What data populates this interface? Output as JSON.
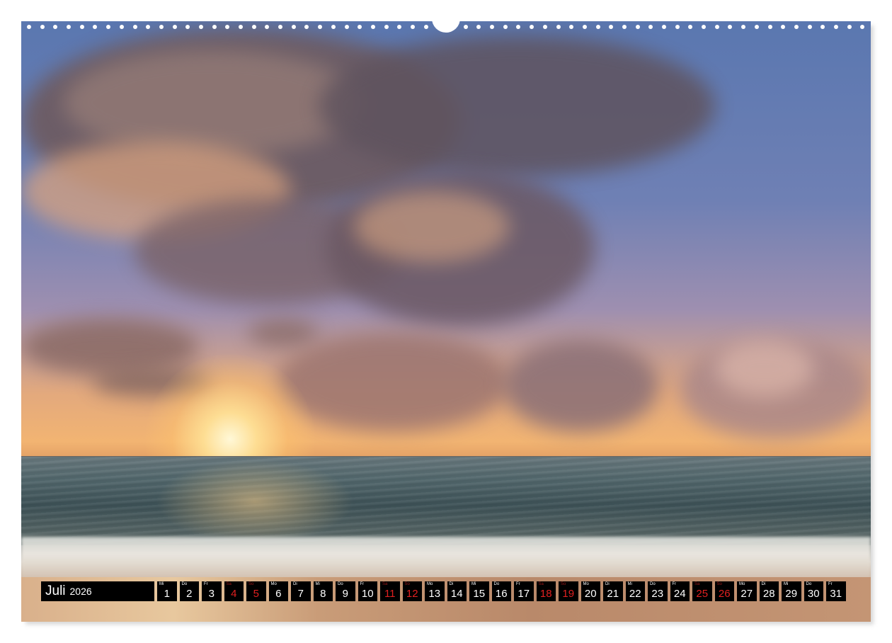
{
  "calendar": {
    "month": "Juli",
    "year": "2026",
    "days": [
      {
        "wd": "Mi",
        "num": "1",
        "weekend": false
      },
      {
        "wd": "Do",
        "num": "2",
        "weekend": false
      },
      {
        "wd": "Fr",
        "num": "3",
        "weekend": false
      },
      {
        "wd": "Sa",
        "num": "4",
        "weekend": true
      },
      {
        "wd": "So",
        "num": "5",
        "weekend": true
      },
      {
        "wd": "Mo",
        "num": "6",
        "weekend": false
      },
      {
        "wd": "Di",
        "num": "7",
        "weekend": false
      },
      {
        "wd": "Mi",
        "num": "8",
        "weekend": false
      },
      {
        "wd": "Do",
        "num": "9",
        "weekend": false
      },
      {
        "wd": "Fr",
        "num": "10",
        "weekend": false
      },
      {
        "wd": "Sa",
        "num": "11",
        "weekend": true
      },
      {
        "wd": "So",
        "num": "12",
        "weekend": true
      },
      {
        "wd": "Mo",
        "num": "13",
        "weekend": false
      },
      {
        "wd": "Di",
        "num": "14",
        "weekend": false
      },
      {
        "wd": "Mi",
        "num": "15",
        "weekend": false
      },
      {
        "wd": "Do",
        "num": "16",
        "weekend": false
      },
      {
        "wd": "Fr",
        "num": "17",
        "weekend": false
      },
      {
        "wd": "Sa",
        "num": "18",
        "weekend": true
      },
      {
        "wd": "So",
        "num": "19",
        "weekend": true
      },
      {
        "wd": "Mo",
        "num": "20",
        "weekend": false
      },
      {
        "wd": "Di",
        "num": "21",
        "weekend": false
      },
      {
        "wd": "Mi",
        "num": "22",
        "weekend": false
      },
      {
        "wd": "Do",
        "num": "23",
        "weekend": false
      },
      {
        "wd": "Fr",
        "num": "24",
        "weekend": false
      },
      {
        "wd": "Sa",
        "num": "25",
        "weekend": true
      },
      {
        "wd": "So",
        "num": "26",
        "weekend": true
      },
      {
        "wd": "Mo",
        "num": "27",
        "weekend": false
      },
      {
        "wd": "Di",
        "num": "28",
        "weekend": false
      },
      {
        "wd": "Mi",
        "num": "29",
        "weekend": false
      },
      {
        "wd": "Do",
        "num": "30",
        "weekend": false
      },
      {
        "wd": "Fr",
        "num": "31",
        "weekend": false
      }
    ]
  },
  "colors": {
    "bar_background": "#000000",
    "weekday_text": "#ffffff",
    "weekend_text": "#e02020"
  },
  "photo": {
    "subject": "sunset-over-sea"
  }
}
